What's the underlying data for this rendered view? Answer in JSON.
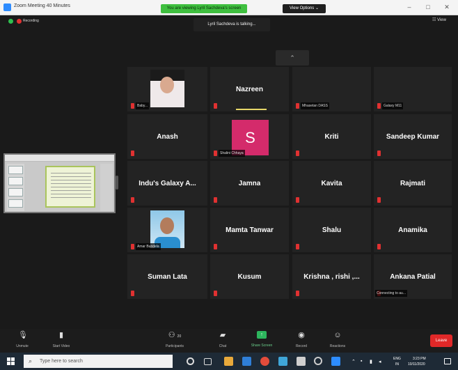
{
  "window": {
    "title": "Zoom Meeting 40 Minutes",
    "share_banner": "You are viewing Lyril Sachdeva's screen",
    "view_options": "View Options ⌄"
  },
  "meeting": {
    "recording_label": "Recording",
    "talking_tooltip": "Lyril Sachdeva is talking...",
    "view_label": "☷ View"
  },
  "participants": [
    {
      "name": "",
      "label": "Baby..."
    },
    {
      "name": "Nazreen",
      "label": ""
    },
    {
      "name": "",
      "label": "Mhasetan DASS"
    },
    {
      "name": "",
      "label": "Galaxy M11"
    },
    {
      "name": "Anash",
      "label": ""
    },
    {
      "name": "",
      "label": "Shalini Chhaya",
      "avatar_letter": "S"
    },
    {
      "name": "Kriti",
      "label": ""
    },
    {
      "name": "Sandeep Kumar",
      "label": ""
    },
    {
      "name": "Indu's Galaxy A...",
      "label": ""
    },
    {
      "name": "Jamna",
      "label": ""
    },
    {
      "name": "Kavita",
      "label": ""
    },
    {
      "name": "Rajmati",
      "label": ""
    },
    {
      "name": "",
      "label": "Amar Bundela"
    },
    {
      "name": "Mamta Tanwar",
      "label": ""
    },
    {
      "name": "Shalu",
      "label": ""
    },
    {
      "name": "Anamika",
      "label": ""
    },
    {
      "name": "Suman Lata",
      "label": ""
    },
    {
      "name": "Kusum",
      "label": ""
    },
    {
      "name": "Krishna , rishi ,...",
      "label": ""
    },
    {
      "name": "Ankana Patial",
      "label": "Connecting to au..."
    }
  ],
  "toolbar": {
    "unmute": "Unmute",
    "start_video": "Start Video",
    "participants": "Participants",
    "participants_count": "20",
    "chat": "Chat",
    "share_screen": "Share Screen",
    "record": "Record",
    "reactions": "Reactions",
    "leave": "Leave"
  },
  "taskbar": {
    "search_placeholder": "Type here to search",
    "lang": "ENG",
    "region": "IN",
    "time": "3:23 PM",
    "date": "10/11/2020"
  },
  "colors": {
    "accent": "#2d8cff",
    "share_green": "#3fbf3f",
    "leave_red": "#e02828",
    "avatar_pink": "#d42b6b"
  }
}
